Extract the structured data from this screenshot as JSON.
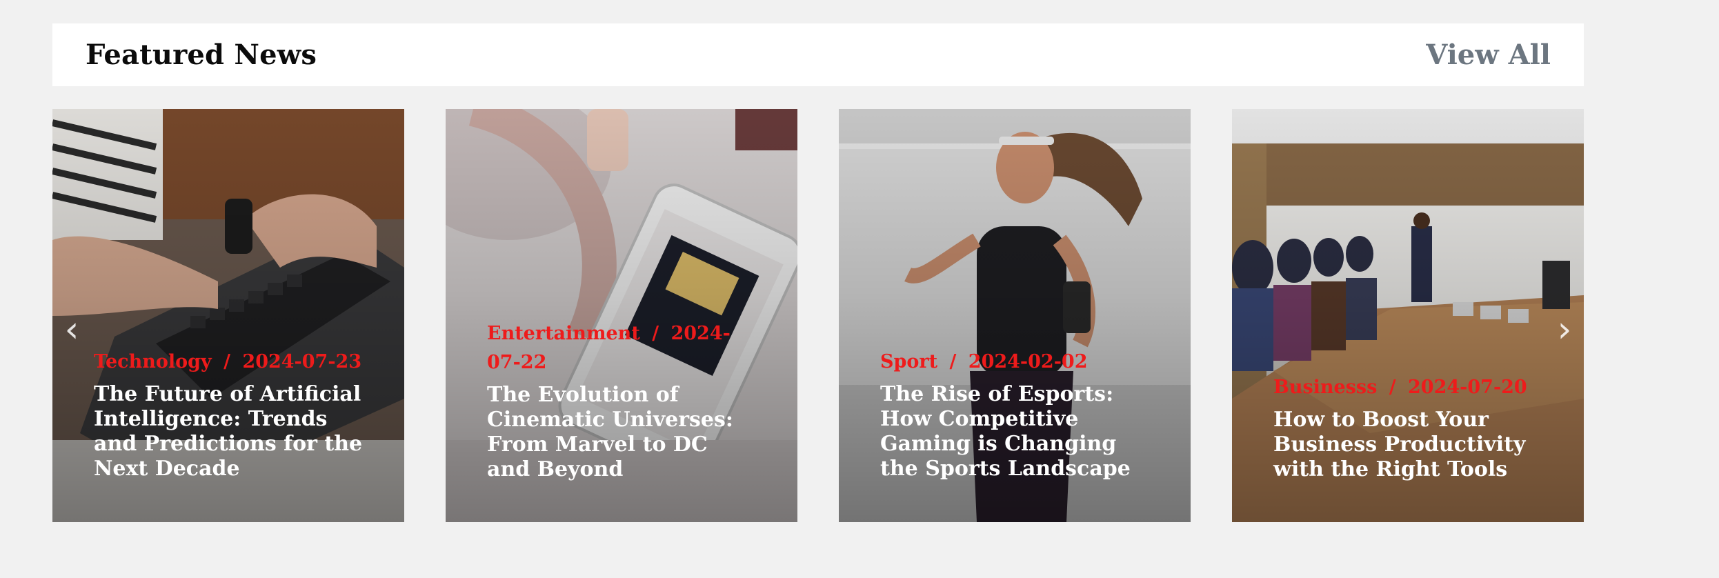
{
  "header": {
    "title": "Featured News",
    "view_all_label": "View All"
  },
  "slider": {
    "prev_icon": "chevron-left-icon",
    "next_icon": "chevron-right-icon"
  },
  "cards": [
    {
      "category": "Technology",
      "separator": "/",
      "date": "2024-07-23",
      "title": "The Future of Artificial Intelligence: Trends and Predictions for the Next Decade"
    },
    {
      "category": "Entertainment",
      "separator": "/",
      "date": "2024-07-22",
      "title": "The Evolution of Cinematic Universes: From Marvel to DC and Beyond"
    },
    {
      "category": "Sport",
      "separator": "/",
      "date": "2024-02-02",
      "title": "The Rise of Esports: How Competitive Gaming is Changing the Sports Landscape"
    },
    {
      "category": "Businesss",
      "separator": "/",
      "date": "2024-07-20",
      "title": "How to Boost Your Business Productivity with the Right Tools"
    }
  ],
  "colors": {
    "category": "#ee1b1b",
    "view_all": "#6c7680",
    "background": "#f1f1f1"
  }
}
